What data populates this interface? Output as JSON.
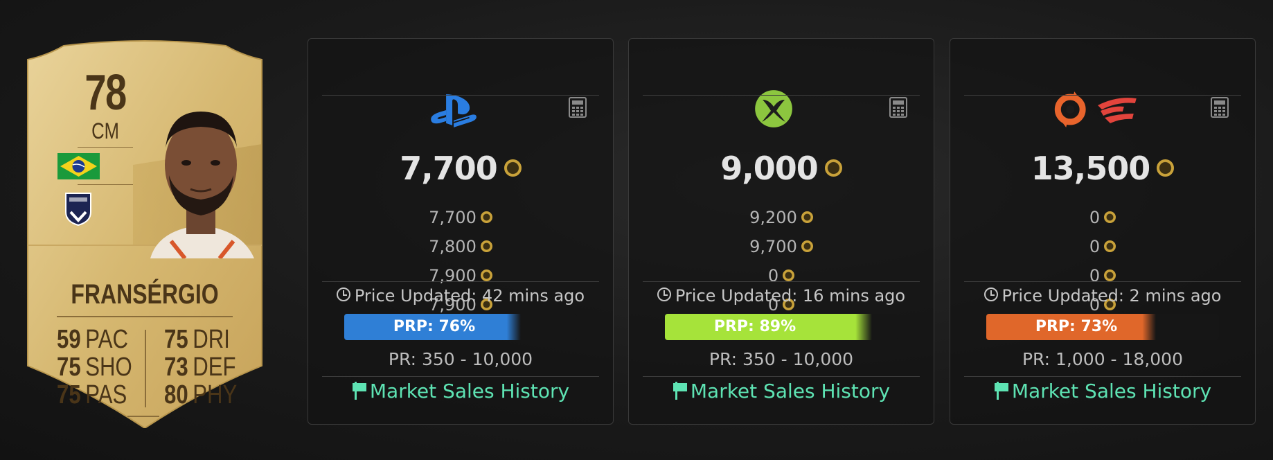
{
  "player": {
    "rating": "78",
    "position": "CM",
    "name": "FRANSÉRGIO",
    "nation_flag": "brazil-flag",
    "club_badge": "bordeaux-badge",
    "stats_left": [
      {
        "value": "59",
        "label": "PAC"
      },
      {
        "value": "75",
        "label": "SHO"
      },
      {
        "value": "75",
        "label": "PAS"
      }
    ],
    "stats_right": [
      {
        "value": "75",
        "label": "DRI"
      },
      {
        "value": "73",
        "label": "DEF"
      },
      {
        "value": "80",
        "label": "PHY"
      }
    ]
  },
  "panels": [
    {
      "platform": "playstation-icon",
      "main_price": "7,700",
      "prices": [
        "7,700",
        "7,800",
        "7,900",
        "7,900"
      ],
      "updated": "Price Updated: 42 mins ago",
      "prp_label": "PRP: 76%",
      "prp_percent": 76,
      "prp_color": "#2f7fd6",
      "pr_range": "PR: 350 - 10,000",
      "market_label": "Market Sales History"
    },
    {
      "platform": "xbox-icon",
      "main_price": "9,000",
      "prices": [
        "9,200",
        "9,700",
        "0",
        "0"
      ],
      "updated": "Price Updated: 16 mins ago",
      "prp_label": "PRP: 89%",
      "prp_percent": 89,
      "prp_color": "#a6e33a",
      "pr_range": "PR: 350 - 10,000",
      "market_label": "Market Sales History"
    },
    {
      "platform": "origin-stadia-icon",
      "main_price": "13,500",
      "prices": [
        "0",
        "0",
        "0",
        "0"
      ],
      "updated": "Price Updated: 2 mins ago",
      "prp_label": "PRP: 73%",
      "prp_percent": 73,
      "prp_color": "#e0672a",
      "pr_range": "PR: 1,000 - 18,000",
      "market_label": "Market Sales History"
    }
  ],
  "colors": {
    "accent_link": "#5ee3b3",
    "card_gold": "#d9bc78",
    "coin_gold": "#c9a23a"
  }
}
